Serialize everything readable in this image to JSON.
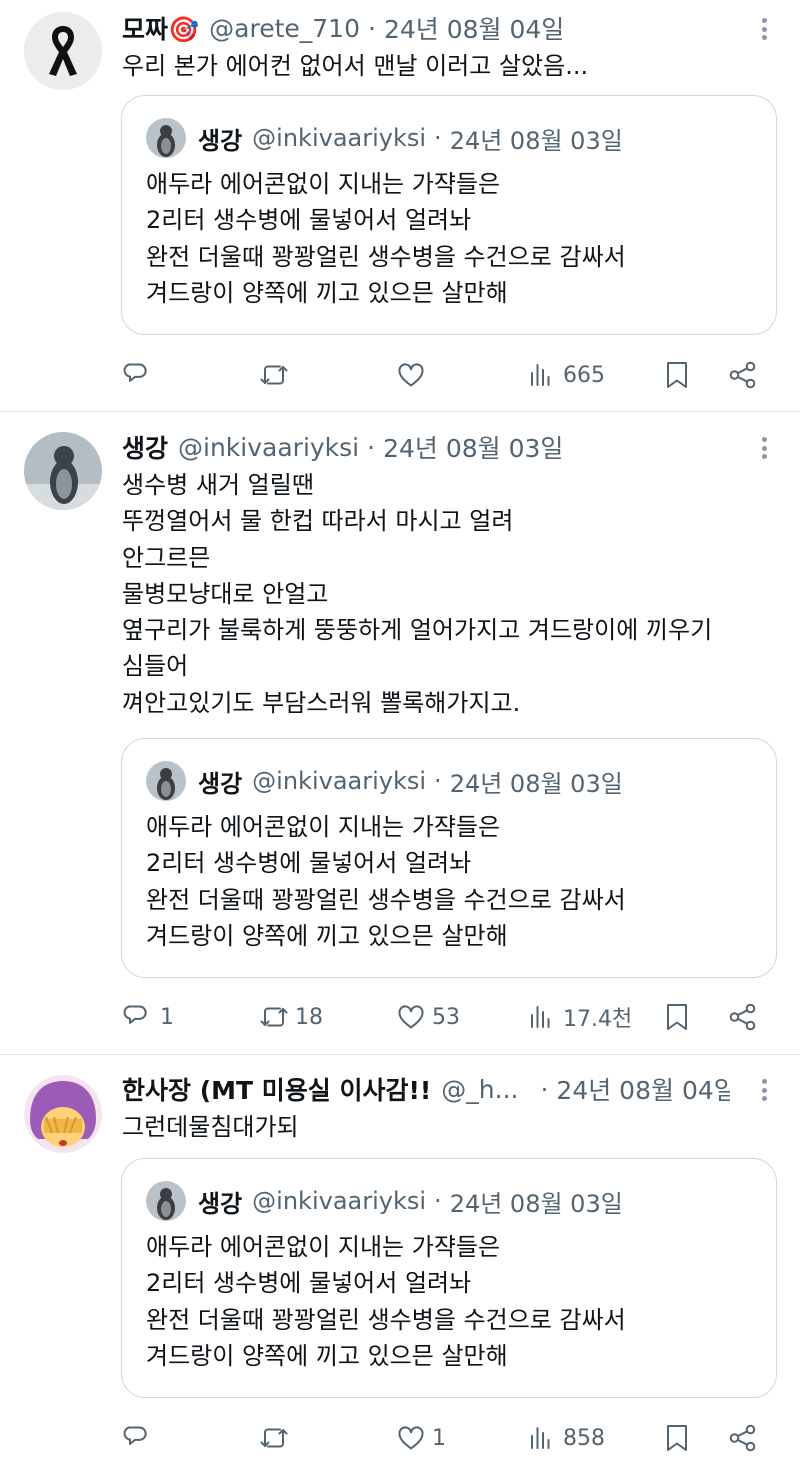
{
  "quoted": {
    "name": "생강",
    "handle": "@inkivaariyksi",
    "sep": "·",
    "date": "24년 08월 03일",
    "lines": [
      "애두라 에어콘없이 지내는 가쟉들은",
      "2리터 생수병에 물넣어서 얼려놔",
      "완전 더울때 꽝꽝얼린 생수병을 수건으로 감싸서",
      "겨드랑이 양쪽에 끼고 있으믄 살만해"
    ]
  },
  "tweets": [
    {
      "name": "모짜🎯",
      "handle": "@arete_710",
      "sep": "·",
      "date": "24년 08월 04일",
      "lines": [
        "우리 본가 에어컨 없어서 맨날 이러고 살았음..."
      ],
      "counts": {
        "reply": "",
        "retweet": "",
        "like": "",
        "views": "665"
      }
    },
    {
      "name": "생강",
      "handle": "@inkivaariyksi",
      "sep": "·",
      "date": "24년 08월 03일",
      "lines": [
        "생수병 새거 얼릴땐",
        "뚜껑열어서 물 한컵 따라서 마시고 얼려",
        "안그르믄",
        "물병모냥대로 안얼고",
        "옆구리가 불룩하게 뚱뚱하게 얼어가지고 겨드랑이에 끼우기",
        "심들어",
        "껴안고있기도 부담스러워  뽈록해가지고."
      ],
      "counts": {
        "reply": "1",
        "retweet": "18",
        "like": "53",
        "views": "17.4천"
      }
    },
    {
      "name": "한사장 (MT 미용실 이사감!!",
      "handle": "@_h...",
      "sep": "·",
      "date": "24년 08월 04일",
      "lines": [
        "그런데물침대가되"
      ],
      "counts": {
        "reply": "",
        "retweet": "",
        "like": "1",
        "views": "858"
      }
    }
  ],
  "icons": {
    "reply": "reply-icon",
    "retweet": "retweet-icon",
    "like": "heart-icon",
    "views": "views-icon",
    "bookmark": "bookmark-icon",
    "share": "share-icon",
    "more": "more-icon"
  },
  "colors": {
    "text": "#0f1419",
    "secondary": "#536471",
    "border": "#cfd9de",
    "divider": "#e6e9ec"
  }
}
